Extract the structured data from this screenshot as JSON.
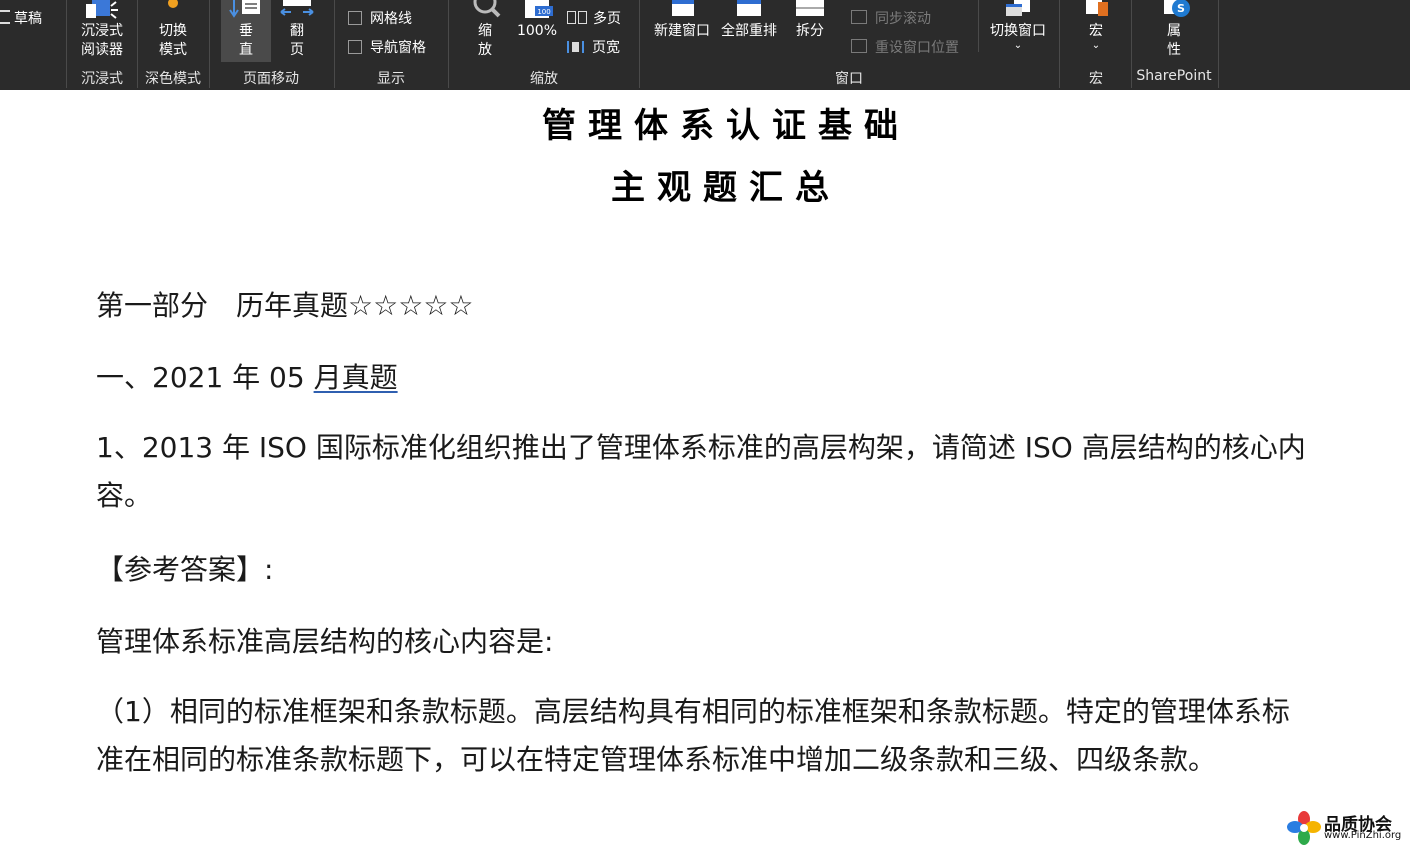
{
  "ribbon": {
    "draft": "草稿",
    "immersive": {
      "button": "沉浸式\n阅读器",
      "group": "沉浸式"
    },
    "dark": {
      "button": "切换\n模式",
      "group": "深色模式"
    },
    "page_move": {
      "vertical": "垂\n直",
      "flip": "翻\n页",
      "group": "页面移动"
    },
    "show": {
      "gridlines": "网格线",
      "nav_pane": "导航窗格",
      "group": "显示"
    },
    "zoom": {
      "zoom": "缩\n放",
      "percent": "100%",
      "multi_page": "多页",
      "page_width": "页宽",
      "group": "缩放"
    },
    "window": {
      "new_window": "新建窗口",
      "arrange_all": "全部重排",
      "split": "拆分",
      "sync_scroll": "同步滚动",
      "reset_position": "重设窗口位置",
      "switch_window": "切换窗口",
      "group": "窗口"
    },
    "macro": {
      "button": "宏",
      "group": "宏"
    },
    "sharepoint": {
      "button": "属\n性",
      "group": "SharePoint"
    }
  },
  "document": {
    "title_line1": "管理体系认证基础",
    "title_line2": "主观题汇总",
    "part_label": "第一部分",
    "part_title": "历年真题☆☆☆☆☆",
    "section_prefix": "一、2021 年 05 ",
    "section_underlined": "月真题",
    "question": "1、2013 年 ISO 国际标准化组织推出了管理体系标准的高层构架，请简述 ISO 高层结构的核心内容。",
    "answer_label": "【参考答案】:",
    "answer_intro": "管理体系标准高层结构的核心内容是:",
    "answer_item1": "（1）相同的标准框架和条款标题。高层结构具有相同的标准框架和条款标题。特定的管理体系标准在相同的标准条款标题下，可以在特定管理体系标准中增加二级条款和三级、四级条款。"
  },
  "watermark": {
    "name": "品质协会",
    "url": "www.PinZhi.org"
  },
  "colors": {
    "ribbon_bg": "#2b2b2b",
    "link_underline": "#2f5fb0"
  }
}
